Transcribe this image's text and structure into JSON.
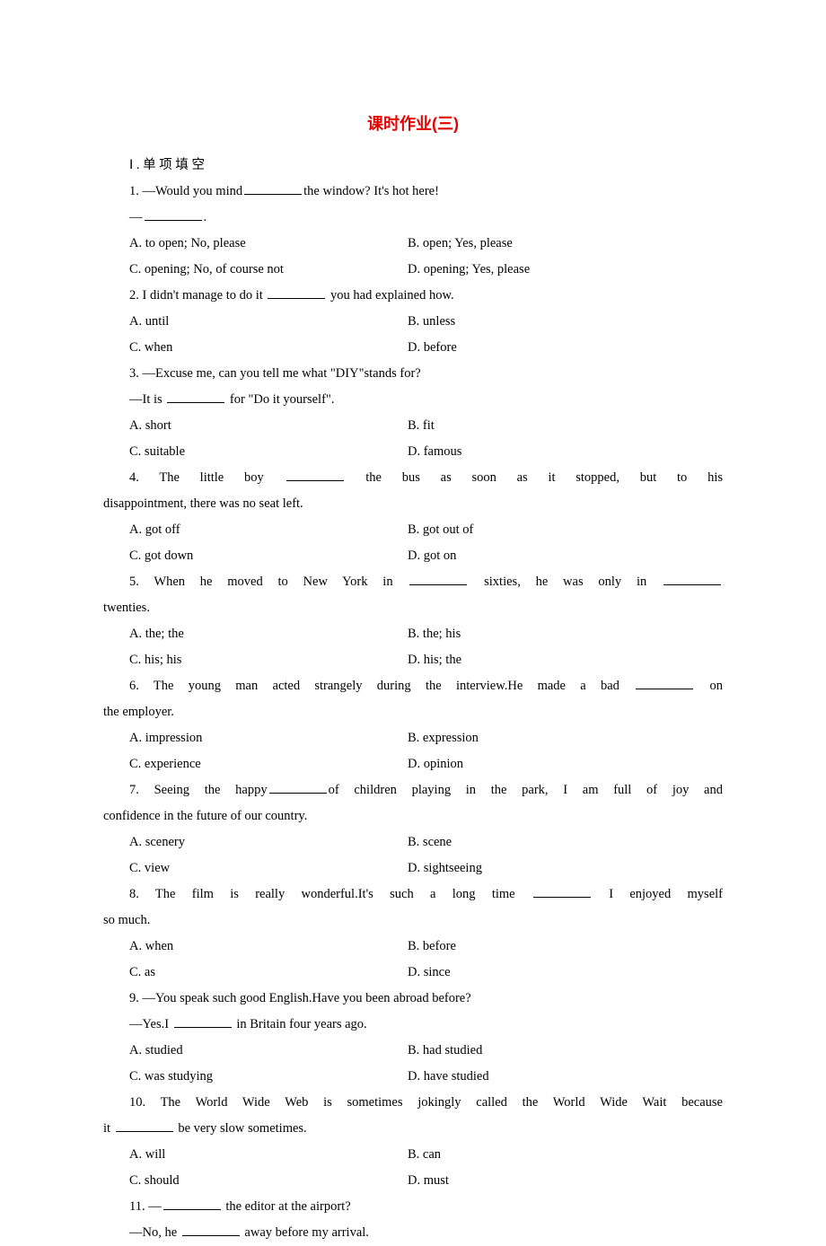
{
  "title": "课时作业(三)",
  "section": "Ⅰ.单项填空",
  "q1": {
    "stem_a": "1. —Would you mind",
    "stem_b": "the window? It's hot here!",
    "stem2": "—",
    "stem2b": ".",
    "A": "A. to open; No, please",
    "B": "B. open; Yes, please",
    "C": "C. opening; No, of course not",
    "D": "D. opening; Yes, please"
  },
  "q2": {
    "stem_a": "2. I didn't manage to do it ",
    "stem_b": " you had explained how.",
    "A": "A. until",
    "B": "B. unless",
    "C": "C. when",
    "D": "D. before"
  },
  "q3": {
    "stem": "3. —Excuse me, can you tell me what \"DIY\"stands for?",
    "stem2a": "—It is ",
    "stem2b": " for \"Do it yourself\".",
    "A": "A. short",
    "B": "B. fit",
    "C": "C. suitable",
    "D": "D. famous"
  },
  "q4": {
    "stem_a": "4. The little boy ",
    "stem_b": " the bus as soon as it stopped, but to his",
    "cont": "disappointment, there was no seat left.",
    "A": "A. got off",
    "B": "B. got out of",
    "C": "C. got down",
    "D": "D. got on"
  },
  "q5": {
    "stem_a": "5. When he moved to New York in ",
    "stem_b": " sixties, he was only in ",
    "cont": "twenties.",
    "A": "A. the; the",
    "B": "B. the; his",
    "C": "C. his; his",
    "D": "D. his; the"
  },
  "q6": {
    "stem_a": "6. The young man acted strangely during the interview.He made a bad ",
    "stem_b": " on",
    "cont": "the employer.",
    "A": "A. impression",
    "B": "B. expression",
    "C": "C. experience",
    "D": "D. opinion"
  },
  "q7": {
    "stem_a": "7. Seeing the happy",
    "stem_b": "of children playing in the park, I am full of joy and",
    "cont": "confidence in the future of our country.",
    "A": "A. scenery",
    "B": "B. scene",
    "C": "C. view",
    "D": "D. sightseeing"
  },
  "q8": {
    "stem_a": "8. The film is really wonderful.It's such a long time ",
    "stem_b": " I enjoyed myself",
    "cont": "so much.",
    "A": "A. when",
    "B": "B. before",
    "C": "C. as",
    "D": "D. since"
  },
  "q9": {
    "stem": "9. —You speak such good English.Have you been abroad before?",
    "stem2a": "—Yes.I ",
    "stem2b": " in Britain four years ago.",
    "A": "A. studied",
    "B": "B. had studied",
    "C": "C. was studying",
    "D": "D. have studied"
  },
  "q10": {
    "stem": "10. The World Wide Web is sometimes jokingly called the World Wide Wait because",
    "cont_a": "it ",
    "cont_b": " be very slow sometimes.",
    "A": "A. will",
    "B": "B. can",
    "C": "C. should",
    "D": "D. must"
  },
  "q11": {
    "stem_a": "11. —",
    "stem_b": " the editor at the airport?",
    "stem2a": "—No, he ",
    "stem2b": " away before my arrival."
  }
}
